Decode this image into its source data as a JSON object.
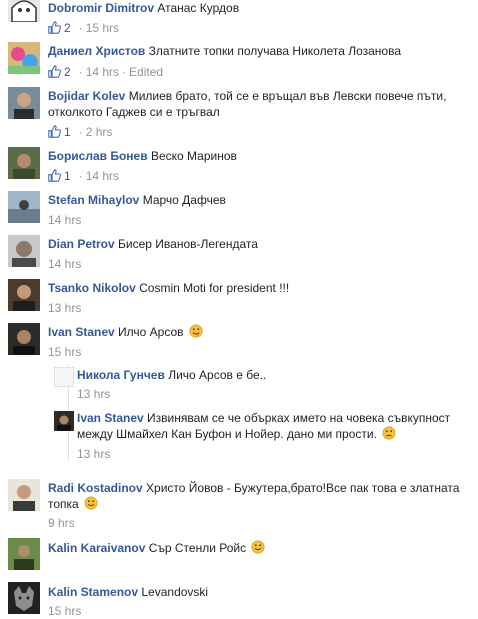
{
  "comments": [
    {
      "author": "Dobromir Dimitrov",
      "text": "Атанас Курдов",
      "likes": "2",
      "time": "15 hrs"
    },
    {
      "author": "Даниел Христов",
      "text": "Златните топки получава Николета Лозанова",
      "likes": "2",
      "time": "14 hrs",
      "edited": "Edited"
    },
    {
      "author": "Bojidar Kolev",
      "text": "Милиев брато, той се е връщал във Левски повече пъти, отколкото Гаджев си е тръгвал",
      "likes": "1",
      "time": "2 hrs"
    },
    {
      "author": "Борислав Бонев",
      "text": "Веско Маринов",
      "likes": "1",
      "time": "14 hrs"
    },
    {
      "author": "Stefan Mihaylov",
      "text": "Марчо Дафчев",
      "time": "14 hrs"
    },
    {
      "author": "Dian Petrov",
      "text": "Бисер Иванов-Легендата",
      "time": "14 hrs"
    },
    {
      "author": "Tsanko Nikolov",
      "text": "Cosmin Moti for president !!!",
      "time": "13 hrs"
    },
    {
      "author": "Ivan Stanev",
      "text": "Илчо Арсов",
      "time": "15 hrs",
      "emoji": "tongue-emoji"
    }
  ],
  "replies": [
    {
      "author": "Никола Гунчев",
      "text": "Личо Арсов е бе..",
      "time": "13 hrs"
    },
    {
      "author": "Ivan Stanev",
      "text": "Извинявам се че обърках името на човека съвкупност между Шмайхел Кан Буфон и Нойер. дано ми прости.",
      "time": "13 hrs",
      "emoji": "frown-emoji"
    }
  ],
  "comments2": [
    {
      "author": "Radi Kostadinov",
      "text": "Христо Йовов - Бужутера,брато!Все пак това е златната топка",
      "time": "9 hrs",
      "emoji": "smile-emoji"
    },
    {
      "author": "Kalin Karaivanov",
      "text": "Сър Стенли Ройс",
      "emoji": "smile-emoji"
    },
    {
      "author": "Kalin Stamenov",
      "text": "Levandovski",
      "time": "15 hrs"
    }
  ],
  "colors": {
    "author": "#365899",
    "meta": "#90949c",
    "text": "#1d2129",
    "like_icon": "#4267b2"
  }
}
